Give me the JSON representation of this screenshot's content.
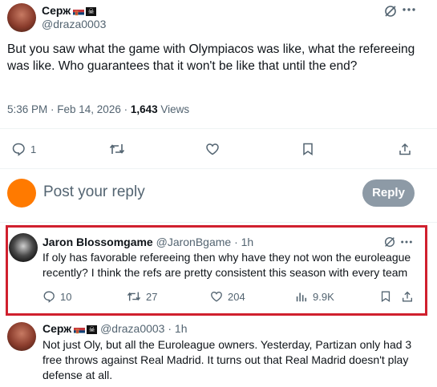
{
  "main_tweet": {
    "author_name": "Серж",
    "handle": "@draza0003",
    "text": "But you saw what the game with Olympiacos was like, what the refereeing was like. Who guarantees that it won't be like that until the end?",
    "time": "5:36 PM · Feb 14, 2026 · ",
    "views_count": "1,643",
    "views_label": " Views",
    "reply_count": "1"
  },
  "composer": {
    "placeholder": "Post your reply",
    "reply_button": "Reply"
  },
  "reply1": {
    "author_name": "Jaron Blossomgame",
    "handle": "@JaronBgame",
    "time": "· 1h",
    "text": "If oly has favorable refereeing then why have they not won the euroleague recently? I think the refs are pretty consistent this season with every team",
    "replies": "10",
    "reposts": "27",
    "likes": "204",
    "views": "9.9K"
  },
  "reply2": {
    "author_name": "Серж",
    "handle": "@draza0003",
    "time": "· 1h",
    "text": "Not just Oly, but all the Euroleague owners. Yesterday, Partizan only had 3 free throws against Real Madrid. It turns out that Real Madrid doesn't play defense at all."
  },
  "colors": {
    "accent": "#1d9bf0",
    "highlight_border": "#d0202e",
    "avatar_placeholder": "#ff7a00"
  }
}
